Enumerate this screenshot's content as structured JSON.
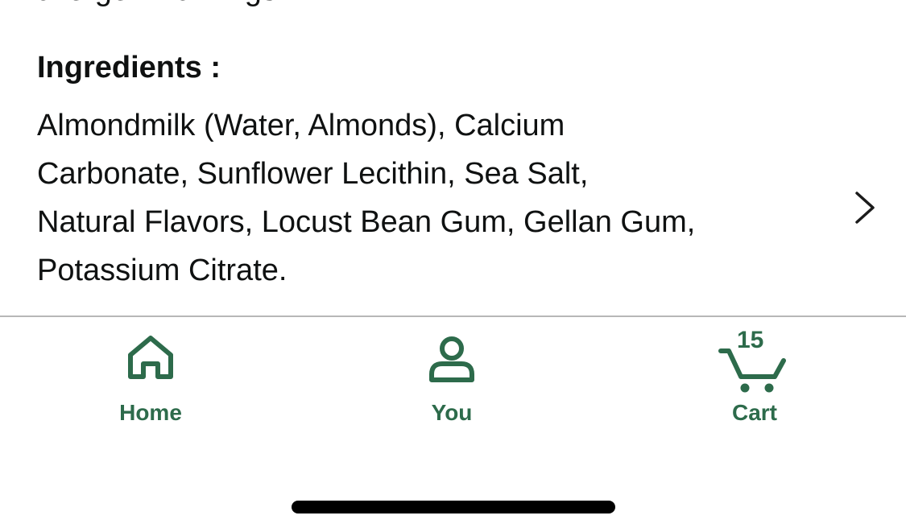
{
  "previous_section": {
    "partial_text": "allergen warnings"
  },
  "ingredients": {
    "title": "Ingredients :",
    "lines": [
      "Almondmilk (Water, Almonds), Calcium",
      "Carbonate, Sunflower Lecithin, Sea Salt,",
      "Natural Flavors, Locust Bean Gum, Gellan Gum,",
      "Potassium Citrate."
    ],
    "chevron_icon": "chevron-right-icon"
  },
  "tab_bar": {
    "accent_color": "#2d6b4b",
    "tabs": [
      {
        "label": "Home",
        "icon": "home-icon"
      },
      {
        "label": "You",
        "icon": "user-icon"
      },
      {
        "label": "Cart",
        "icon": "cart-icon",
        "count": "15"
      }
    ]
  }
}
